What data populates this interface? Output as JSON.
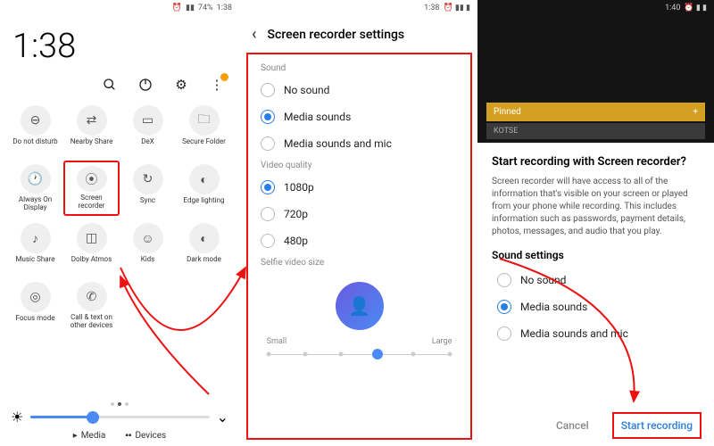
{
  "panel1": {
    "status": {
      "battery": "74%",
      "time": "1:38"
    },
    "clock": "1:38",
    "quick_settings": [
      {
        "label": "Do not disturb",
        "icon": "⊖"
      },
      {
        "label": "Nearby Share",
        "icon": "⇄"
      },
      {
        "label": "DeX",
        "icon": "▭"
      },
      {
        "label": "Secure Folder",
        "icon": "🗀"
      },
      {
        "label": "Always On Display",
        "icon": "🕐"
      },
      {
        "label": "Screen recorder",
        "icon": "⦿",
        "highlighted": true
      },
      {
        "label": "Sync",
        "icon": "↻"
      },
      {
        "label": "Edge lighting",
        "icon": "◐"
      },
      {
        "label": "Music Share",
        "icon": "♪"
      },
      {
        "label": "Dolby Atmos",
        "icon": "◫"
      },
      {
        "label": "Kids",
        "icon": "☺"
      },
      {
        "label": "Dark mode",
        "icon": "◐"
      },
      {
        "label": "Focus mode",
        "icon": "◎"
      },
      {
        "label": "Call & text on other devices",
        "icon": "✆"
      }
    ],
    "brightness_pct": 35,
    "tabs": {
      "media": "Media",
      "devices": "Devices"
    }
  },
  "panel2": {
    "status_time": "1:38",
    "title": "Screen recorder settings",
    "sound_label": "Sound",
    "sound_options": [
      "No sound",
      "Media sounds",
      "Media sounds and mic"
    ],
    "sound_selected": 1,
    "vq_label": "Video quality",
    "vq_options": [
      "1080p",
      "720p",
      "480p"
    ],
    "vq_selected": 0,
    "selfie_label": "Selfie video size",
    "size_small": "Small",
    "size_large": "Large",
    "size_ticks": 6,
    "size_value": 3
  },
  "panel3": {
    "status_time": "1:40",
    "pinned_label": "Pinned",
    "pinned_plus": "+",
    "kotse": "KOTSE",
    "title": "Start recording with Screen recorder?",
    "desc": "Screen recorder will have access to all of the information that's visible on your screen or played from your phone while recording. This includes information such as passwords, payment details, photos, messages, and audio that you play.",
    "sound_title": "Sound settings",
    "sound_options": [
      "No sound",
      "Media sounds",
      "Media sounds and mic"
    ],
    "sound_selected": 1,
    "cancel": "Cancel",
    "start": "Start recording"
  }
}
